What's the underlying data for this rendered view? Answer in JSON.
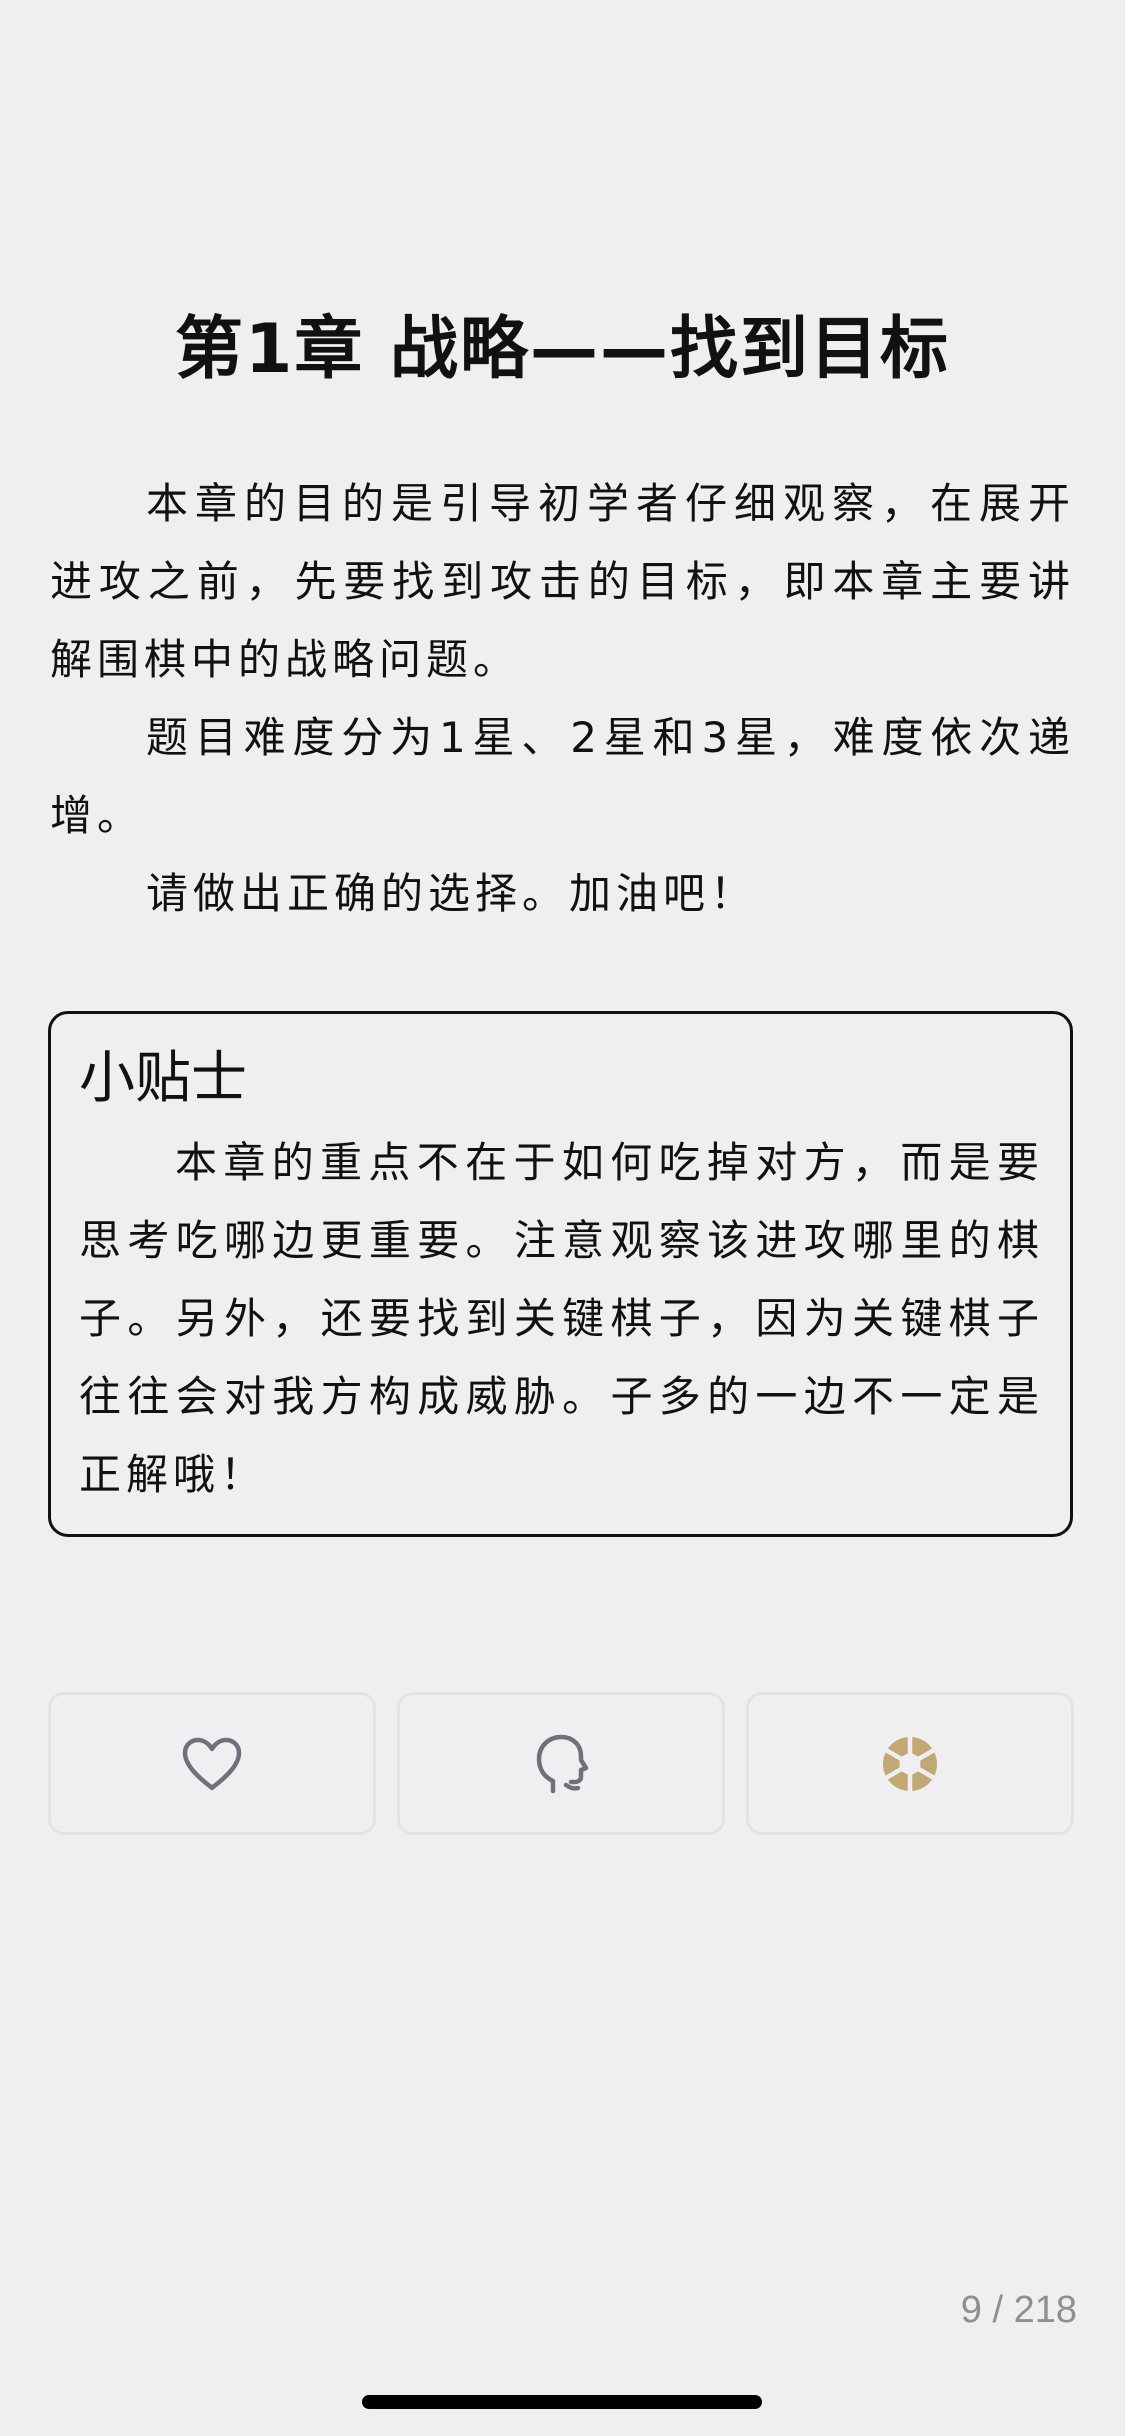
{
  "chapter": {
    "title": "第1章 战略——找到目标"
  },
  "intro": {
    "paragraphs": [
      "本章的目的是引导初学者仔细观察，在展开进攻之前，先要找到攻击的目标，即本章主要讲解围棋中的战略问题。",
      "题目难度分为1星、2星和3星，难度依次递增。",
      "请做出正确的选择。加油吧！"
    ]
  },
  "tips": {
    "title": "小贴士",
    "body": "本章的重点不在于如何吃掉对方，而是要思考吃哪边更重要。注意观察该进攻哪里的棋子。另外，还要找到关键棋子，因为关键棋子往往会对我方构成威胁。子多的一边不一定是正解哦！"
  },
  "actions": {
    "like_icon": "heart-outline-icon",
    "voice_icon": "speaking-head-icon",
    "camera_icon": "aperture-icon",
    "icon_color": "#6e7179",
    "accent_color": "#c2a874"
  },
  "pagination": {
    "label": "9 / 218"
  },
  "colors": {
    "background": "#efeff2",
    "text": "#111111",
    "border": "#111111",
    "muted": "#8e8e93"
  }
}
